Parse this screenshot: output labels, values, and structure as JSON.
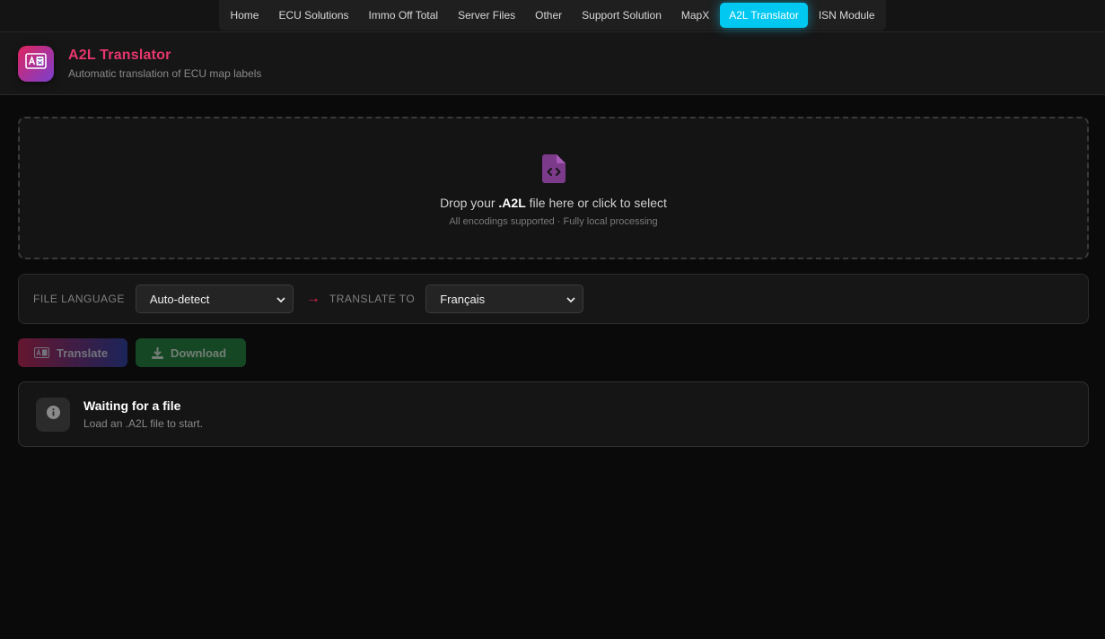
{
  "nav": {
    "items": [
      {
        "label": "Home"
      },
      {
        "label": "ECU Solutions"
      },
      {
        "label": "Immo Off Total"
      },
      {
        "label": "Server Files"
      },
      {
        "label": "Other"
      },
      {
        "label": "Support Solution"
      },
      {
        "label": "MapX"
      },
      {
        "label": "A2L Translator",
        "active": true
      },
      {
        "label": "ISN Module"
      }
    ],
    "active_color": "#00c8f0"
  },
  "header": {
    "icon": "translate-icon",
    "title": "A2L Translator",
    "subtitle": "Automatic translation of ECU map labels",
    "title_color": "#e8366e"
  },
  "dropzone": {
    "icon": "file-code-icon",
    "text_prefix": "Drop your ",
    "text_ext": ".A2L",
    "text_suffix": " file here or click to select",
    "subtext": "All encodings supported · Fully local processing"
  },
  "languages": {
    "source_label": "FILE LANGUAGE",
    "source_value": "Auto-detect",
    "arrow": "→",
    "target_label": "TRANSLATE TO",
    "target_value": "Français"
  },
  "actions": {
    "translate_label": "Translate",
    "download_label": "Download"
  },
  "status": {
    "icon": "info-icon",
    "title": "Waiting for a file",
    "subtitle": "Load an .A2L file to start."
  }
}
